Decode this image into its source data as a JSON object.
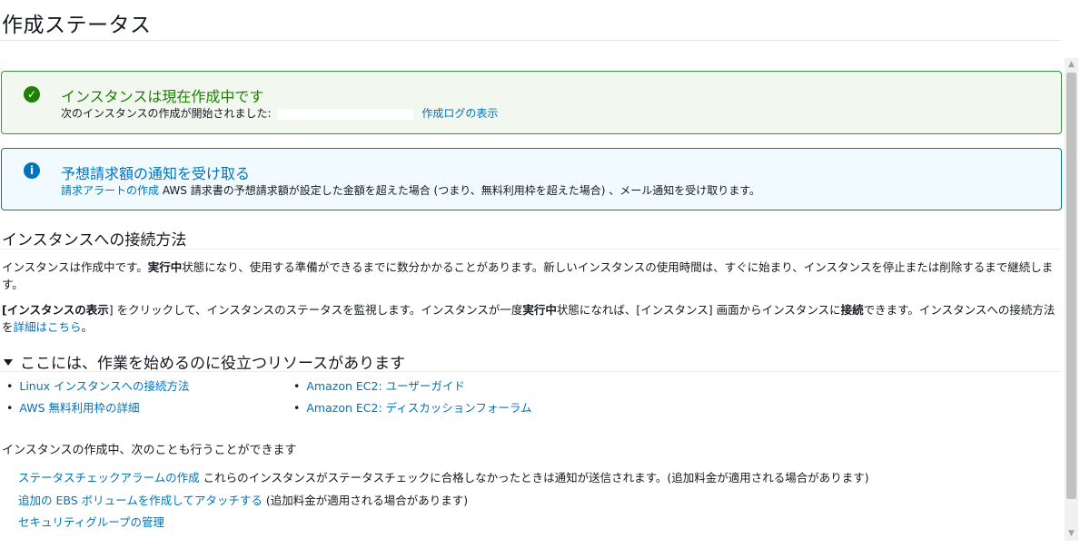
{
  "page": {
    "title": "作成ステータス"
  },
  "success_alert": {
    "title": "インスタンスは現在作成中です",
    "body_text": "次のインスタンスの作成が開始されました:",
    "link": "作成ログの表示"
  },
  "info_alert": {
    "title": "予想請求額の通知を受け取る",
    "link": "請求アラートの作成",
    "body_text": "AWS 請求書の予想請求額が設定した金額を超えた場合 (つまり、無料利用枠を超えた場合) 、メール通知を受け取ります。"
  },
  "connect": {
    "heading": "インスタンスへの接続方法",
    "p1_a": "インスタンスは作成中です。",
    "p1_bold": "実行中",
    "p1_b": "状態になり、使用する準備ができるまでに数分かかることがあります。新しいインスタンスの使用時間は、すぐに始まり、インスタンスを停止または削除するまで継続します。",
    "p2_br1": "[",
    "p2_bold1": "インスタンスの表示",
    "p2_br2": "]",
    "p2_a": " をクリックして、インスタンスのステータスを監視します。インスタンスが一度",
    "p2_bold2": "実行中",
    "p2_b": "状態になれば、[インスタンス] 画面からインスタンスに",
    "p2_bold3": "接続",
    "p2_c": "できます。インスタンスへの接続方法を",
    "p2_link": "詳細はこちら",
    "p2_end": "。"
  },
  "resources": {
    "heading": "ここには、作業を始めるのに役立つリソースがあります",
    "bullet": "•",
    "items": [
      "Linux インスタンスへの接続方法",
      "AWS 無料利用枠の詳細",
      "Amazon EC2: ユーザーガイド",
      "Amazon EC2: ディスカッションフォーラム"
    ]
  },
  "actions": {
    "intro": "インスタンスの作成中、次のことも行うことができます",
    "items": [
      {
        "link": "ステータスチェックアラームの作成",
        "text": " これらのインスタンスがステータスチェックに合格しなかったときは通知が送信されます。(追加料金が適用される場合があります)"
      },
      {
        "link": "追加の EBS ボリュームを作成してアタッチする",
        "text": " (追加料金が適用される場合があります)"
      },
      {
        "link": "セキュリティグループの管理",
        "text": ""
      }
    ]
  },
  "icons": {
    "success": "check-circle-icon",
    "info": "info-circle-icon",
    "caret": "caret-down-icon"
  },
  "colors": {
    "link": "#0073bb",
    "success": "#1d8102",
    "success_bg": "#f2f8f0",
    "info_bg": "#f1faff"
  }
}
